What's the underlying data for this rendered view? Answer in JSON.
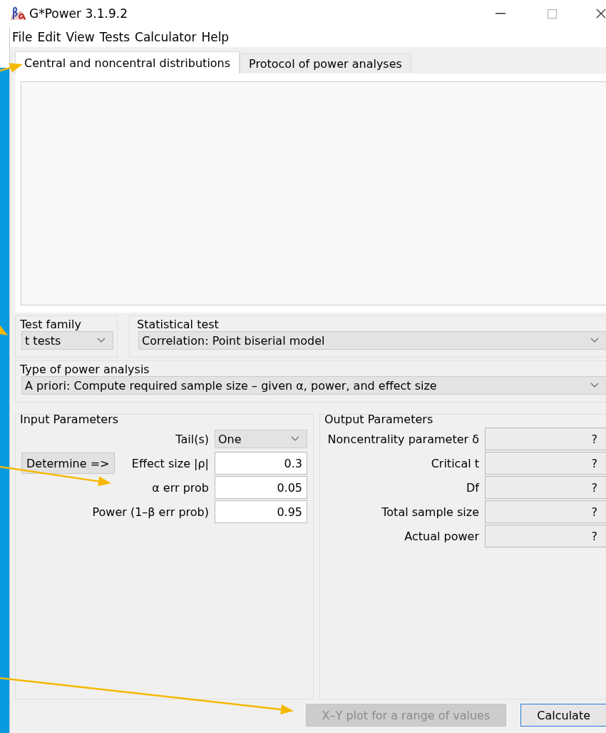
{
  "window": {
    "title": "G*Power 3.1.9.2"
  },
  "menu": [
    "File",
    "Edit",
    "View",
    "Tests",
    "Calculator",
    "Help"
  ],
  "tabs": [
    {
      "label": "Central and noncentral distributions",
      "selected": true
    },
    {
      "label": "Protocol of power analyses",
      "selected": false
    }
  ],
  "test_family": {
    "label": "Test family",
    "value": "t tests"
  },
  "statistical_test": {
    "label": "Statistical test",
    "value": "Correlation: Point biserial model"
  },
  "type_of_power_analysis": {
    "label": "Type of power analysis",
    "value": "A priori: Compute required sample size – given α, power, and effect size"
  },
  "input_parameters": {
    "title": "Input Parameters",
    "determine_button": "Determine =>",
    "rows": [
      {
        "kind": "select",
        "label": "Tail(s)",
        "value": "One"
      },
      {
        "kind": "field",
        "label": "Effect size |ρ|",
        "value": "0.3"
      },
      {
        "kind": "field",
        "label": "α err prob",
        "value": "0.05"
      },
      {
        "kind": "field",
        "label": "Power (1–β err prob)",
        "value": "0.95"
      }
    ]
  },
  "output_parameters": {
    "title": "Output Parameters",
    "rows": [
      {
        "label": "Noncentrality parameter δ",
        "value": "?"
      },
      {
        "label": "Critical t",
        "value": "?"
      },
      {
        "label": "Df",
        "value": "?"
      },
      {
        "label": "Total sample size",
        "value": "?"
      },
      {
        "label": "Actual power",
        "value": "?"
      }
    ]
  },
  "buttons": [
    {
      "label": "X–Y plot for a range of values",
      "disabled": true
    },
    {
      "label": "Calculate",
      "disabled": false
    }
  ]
}
